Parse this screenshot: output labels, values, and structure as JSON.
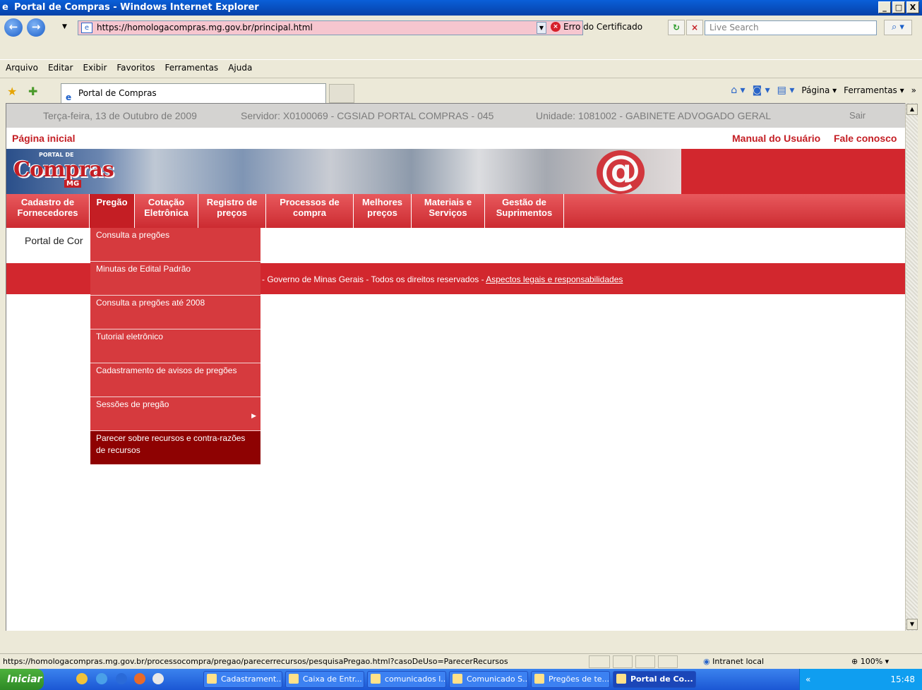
{
  "window": {
    "title": "Portal de Compras - Windows Internet Explorer",
    "min": "_",
    "max": "□",
    "close": "X"
  },
  "address": {
    "url": "https://homologacompras.mg.gov.br/principal.html",
    "cert_warning": "Erro do Certificado",
    "search_placeholder": "Live Search"
  },
  "menu": [
    "Arquivo",
    "Editar",
    "Exibir",
    "Favoritos",
    "Ferramentas",
    "Ajuda"
  ],
  "tab": {
    "title": "Portal de Compras"
  },
  "commandbar": {
    "page": "Página",
    "tools": "Ferramentas"
  },
  "page": {
    "date": "Terça-feira, 13 de Outubro de 2009",
    "server": "Servidor: X0100069 - CGSIAD PORTAL COMPRAS - 045",
    "unit": "Unidade: 1081002 - GABINETE ADVOGADO GERAL",
    "logout": "Sair",
    "home": "Página inicial",
    "manual": "Manual do Usuário",
    "contact": "Fale conosco",
    "logo_text": "Compras",
    "logo_small": "PORTAL DE",
    "logo_mg": "MG",
    "portal_text": "Portal de Cor",
    "footer_text": "- Governo de Minas Gerais - Todos os direitos reservados - ",
    "footer_link": "Aspectos legais e responsabilidades"
  },
  "nav": [
    {
      "line1": "Cadastro de",
      "line2": "Fornecedores"
    },
    {
      "line1": "Pregão",
      "line2": ""
    },
    {
      "line1": "Cotação",
      "line2": "Eletrônica"
    },
    {
      "line1": "Registro de",
      "line2": "preços"
    },
    {
      "line1": "Processos de",
      "line2": "compra"
    },
    {
      "line1": "Melhores",
      "line2": "preços"
    },
    {
      "line1": "Materiais e",
      "line2": "Serviços"
    },
    {
      "line1": "Gestão de",
      "line2": "Suprimentos"
    }
  ],
  "dropdown": [
    "Consulta a pregões",
    "Minutas de Edital Padrão",
    "Consulta a pregões até 2008",
    "Tutorial eletrônico",
    "Cadastramento de avisos de pregões",
    "Sessões de pregão",
    "Parecer sobre recursos e contra-razões de recursos"
  ],
  "status": {
    "url": "https://homologacompras.mg.gov.br/processocompra/pregao/parecerrecursos/pesquisaPregao.html?casoDeUso=ParecerRecursos",
    "zone": "Intranet local",
    "zoom": "100%"
  },
  "taskbar": {
    "start": "Iniciar",
    "items": [
      "Cadastrament...",
      "Caixa de Entr...",
      "comunicados l...",
      "Comunicado S...",
      "Pregões de te...",
      "Portal de Co..."
    ],
    "clock": "15:48"
  },
  "colors": {
    "brand_red": "#d2272e",
    "selected_red": "#8e0202",
    "xp_blue": "#0a5fd8"
  }
}
